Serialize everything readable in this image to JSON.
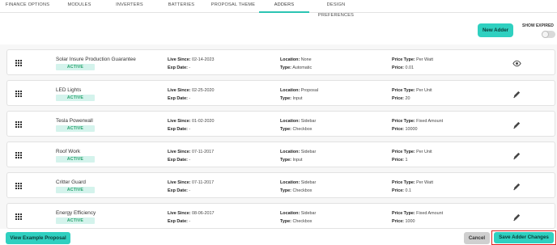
{
  "tabs": [
    {
      "label": "FINANCE OPTIONS",
      "active": false
    },
    {
      "label": "MODULES",
      "active": false
    },
    {
      "label": "INVERTERS",
      "active": false
    },
    {
      "label": "BATTERIES",
      "active": false
    },
    {
      "label": "PROPOSAL THEME",
      "active": false
    },
    {
      "label": "ADDERS",
      "active": true
    },
    {
      "label": "DESIGN PREFERENCES",
      "active": false
    }
  ],
  "toolbar": {
    "new_adder_label": "New Adder",
    "show_expired_label": "SHOW EXPIRED",
    "show_expired_on": false
  },
  "field_labels": {
    "live_since": "Live Since:",
    "exp_date": "Exp Date:",
    "location": "Location:",
    "type": "Type:",
    "price_type": "Price Type:",
    "price": "Price:"
  },
  "adders": [
    {
      "name": "Solar Insure Production Guarantee",
      "status": "ACTIVE",
      "live_since": "02-14-2023",
      "exp_date": "-",
      "location": "None",
      "type": "Automatic",
      "price_type": "Per Watt",
      "price": "0.01",
      "action_icon": "eye-icon"
    },
    {
      "name": "LED Lights",
      "status": "ACTIVE",
      "live_since": "02-25-2020",
      "exp_date": "-",
      "location": "Proposal",
      "type": "Input",
      "price_type": "Per Unit",
      "price": "20",
      "action_icon": "pencil-icon"
    },
    {
      "name": "Tesla Powerwall",
      "status": "ACTIVE",
      "live_since": "01-02-2020",
      "exp_date": "-",
      "location": "Sidebar",
      "type": "Checkbox",
      "price_type": "Fixed Amount",
      "price": "10000",
      "action_icon": "pencil-icon"
    },
    {
      "name": "Roof Work",
      "status": "ACTIVE",
      "live_since": "07-11-2017",
      "exp_date": "-",
      "location": "Sidebar",
      "type": "Input",
      "price_type": "Per Unit",
      "price": "1",
      "action_icon": "pencil-icon"
    },
    {
      "name": "Critter Guard",
      "status": "ACTIVE",
      "live_since": "07-11-2017",
      "exp_date": "-",
      "location": "Sidebar",
      "type": "Checkbox",
      "price_type": "Per Watt",
      "price": "0.1",
      "action_icon": "pencil-icon"
    },
    {
      "name": "Energy Efficiency",
      "status": "ACTIVE",
      "live_since": "08-06-2017",
      "exp_date": "-",
      "location": "Sidebar",
      "type": "Checkbox",
      "price_type": "Fixed Amount",
      "price": "1000",
      "action_icon": "pencil-icon"
    }
  ],
  "footer": {
    "example_label": "View Example Proposal",
    "cancel_label": "Cancel",
    "save_label": "Save Adder Changes"
  },
  "colors": {
    "accent": "#2fd0c0",
    "active_badge_bg": "#d4f3ec",
    "active_badge_text": "#27a36d",
    "highlight_border": "#e02020"
  }
}
